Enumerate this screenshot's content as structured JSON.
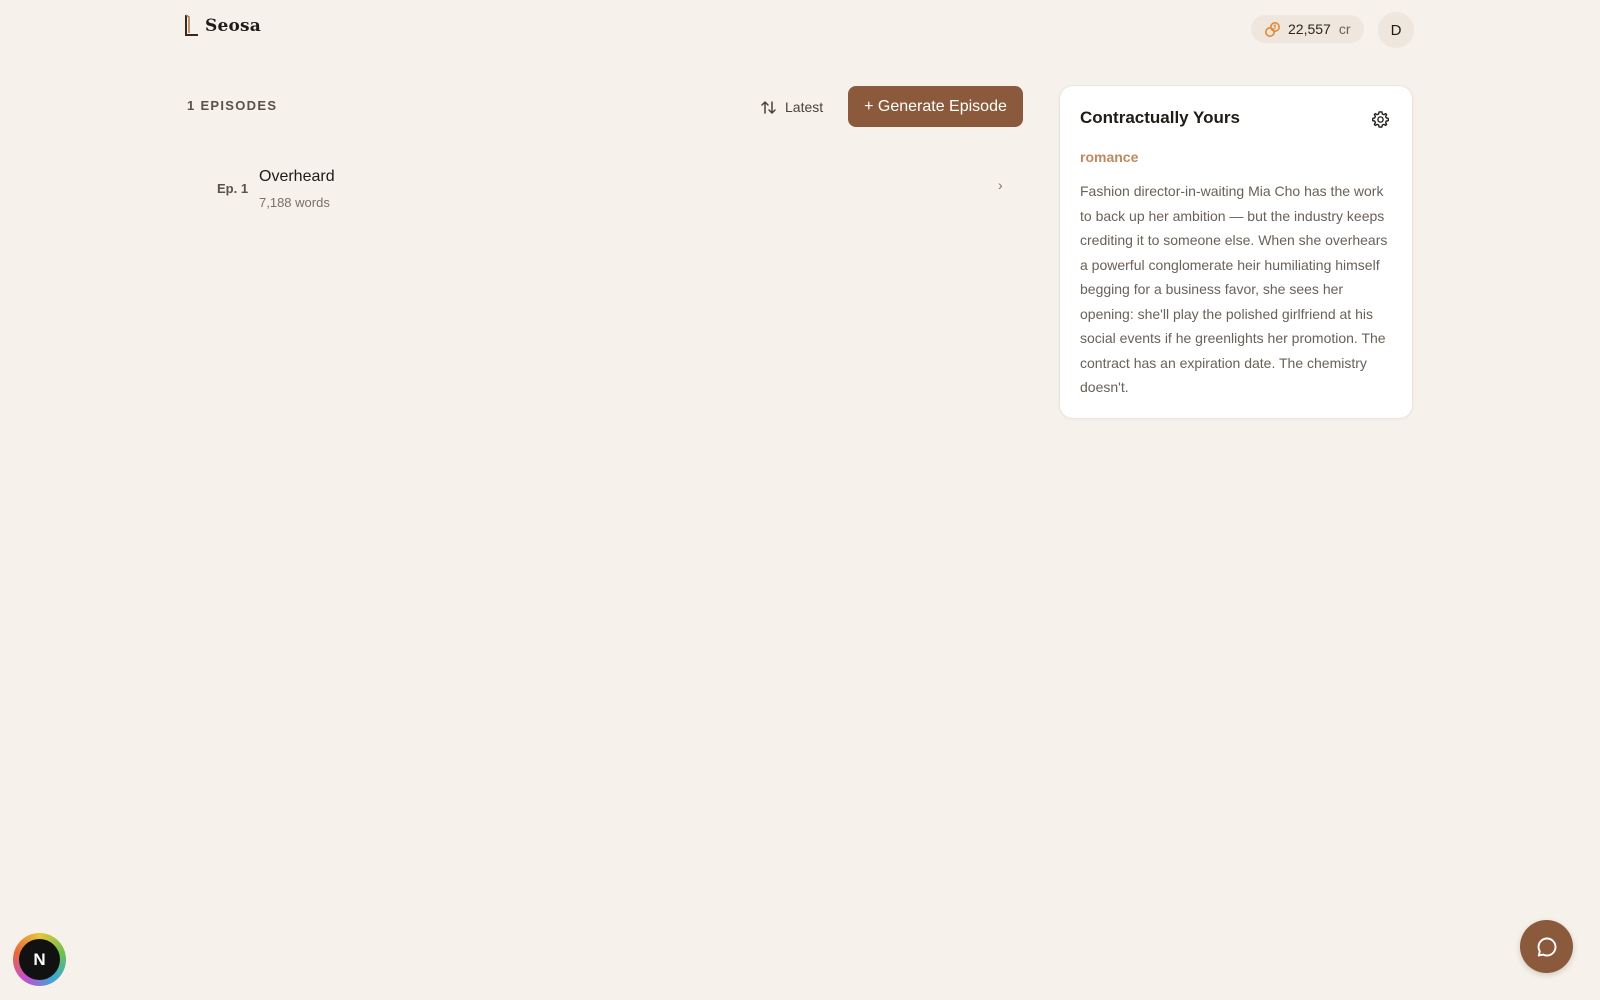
{
  "header": {
    "brand": "Seosa",
    "logo_icon": "seosa-logo-icon",
    "credits": {
      "icon": "coins-icon",
      "amount": "22,557",
      "unit": "cr",
      "icon_color": "#e08a3c"
    },
    "avatar_initial": "D"
  },
  "episodes": {
    "count_label": "1 EPISODES",
    "sort": {
      "icon": "sort-arrows-icon",
      "label": "Latest"
    },
    "generate_label": "+ Generate Episode",
    "items": [
      {
        "number": "Ep. 1",
        "title": "Overheard",
        "words": "7,188 words",
        "chevron": "›"
      }
    ]
  },
  "story": {
    "title": "Contractually Yours",
    "settings_icon": "gear-icon",
    "genre": "romance",
    "description": "Fashion director-in-waiting Mia Cho has the work to back up her ambition — but the industry keeps crediting it to someone else. When she overhears a powerful conglomerate heir humiliating himself begging for a business favor, she sees her opening: she'll play the polished girlfriend at his social events if he greenlights her promotion. The contract has an expiration date. The chemistry doesn't."
  },
  "floating": {
    "dev_badge_letter": "N",
    "chat_icon": "chat-bubble-icon"
  },
  "colors": {
    "background": "#f6f1eb",
    "accent": "#8b5a3c",
    "genre": "#c2875f",
    "pill": "#efe7dd"
  }
}
